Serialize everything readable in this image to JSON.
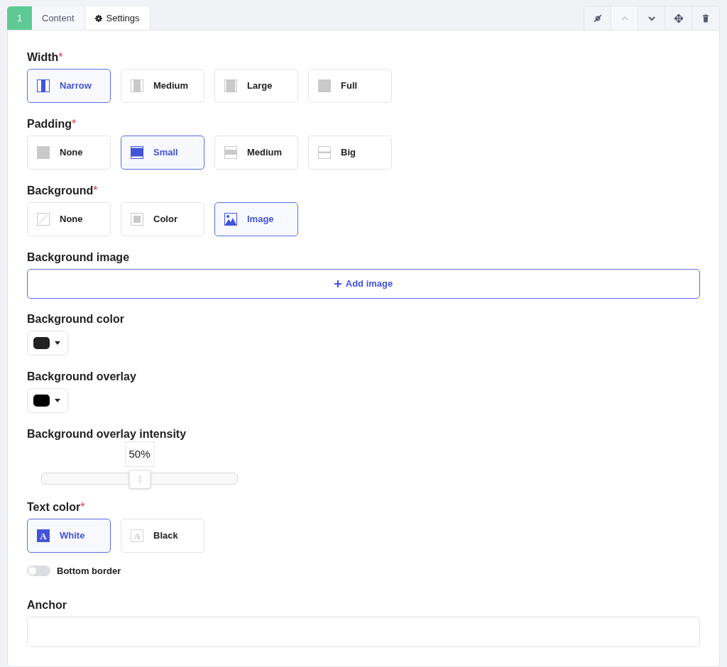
{
  "tabs": [
    {
      "label": "1",
      "kind": "number",
      "selected": false
    },
    {
      "label": "Content",
      "kind": "text",
      "selected": false
    },
    {
      "label": "Settings",
      "kind": "settings",
      "selected": true
    }
  ],
  "toolbar": [
    {
      "kind": "collapse",
      "disabled": false
    },
    {
      "kind": "up",
      "disabled": true
    },
    {
      "kind": "down",
      "disabled": false
    },
    {
      "kind": "move",
      "disabled": false
    },
    {
      "kind": "delete",
      "disabled": false
    }
  ],
  "fields": [
    {
      "kind": "choices",
      "label": "Width",
      "required_mark": "*",
      "options": [
        {
          "label": "Narrow",
          "selected": true
        },
        {
          "label": "Medium",
          "selected": false
        },
        {
          "label": "Large",
          "selected": false
        },
        {
          "label": "Full",
          "selected": false
        }
      ]
    },
    {
      "kind": "choices",
      "label": "Padding",
      "required_mark": "*",
      "options": [
        {
          "label": "None",
          "selected": false
        },
        {
          "label": "Small",
          "selected": true
        },
        {
          "label": "Medium",
          "selected": false
        },
        {
          "label": "Big",
          "selected": false
        }
      ]
    },
    {
      "kind": "choices",
      "label": "Background",
      "required_mark": "*",
      "options": [
        {
          "label": "None",
          "selected": false
        },
        {
          "label": "Color",
          "selected": false
        },
        {
          "label": "Image",
          "selected": true
        }
      ]
    },
    {
      "kind": "image",
      "label": "Background image",
      "button": "Add image"
    },
    {
      "kind": "color",
      "label": "Background color",
      "color": "#222222"
    },
    {
      "kind": "color",
      "label": "Background overlay",
      "color": "#000000"
    },
    {
      "kind": "slider",
      "label": "Background overlay intensity",
      "level": 0.5,
      "reading": "50%"
    },
    {
      "kind": "choices",
      "label": "Text color",
      "required_mark": "*",
      "options": [
        {
          "label": "White",
          "glyph": "A",
          "selected": true
        },
        {
          "label": "Black",
          "glyph": "A",
          "selected": false
        }
      ]
    },
    {
      "kind": "toggle",
      "label": "Bottom border",
      "on": false
    },
    {
      "kind": "text",
      "label": "Anchor"
    }
  ]
}
